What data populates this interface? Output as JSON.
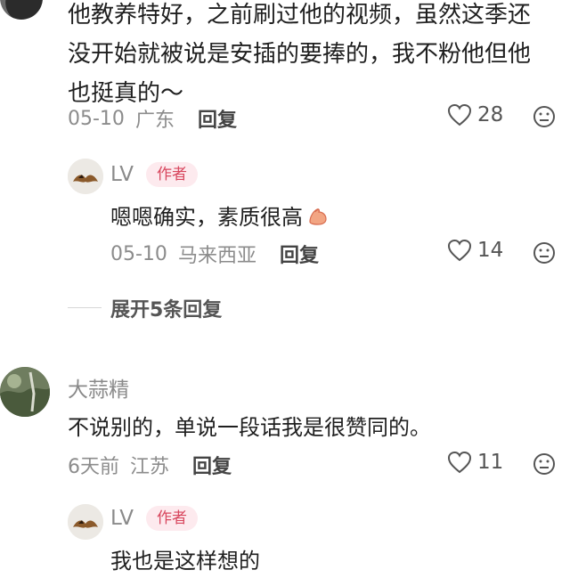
{
  "comments": [
    {
      "text_lines": [
        "他教养特好，之前刷过他的视频，虽然这季还",
        "没开始就被说是安插的要捧的，我不粉他但他",
        "也挺真的～"
      ],
      "date": "05-10",
      "location": "广东",
      "reply_label": "回复",
      "likes": "28",
      "replies": [
        {
          "username": "LV",
          "badge": "作者",
          "text": "嗯嗯确实，素质很高",
          "date": "05-10",
          "location": "马来西亚",
          "reply_label": "回复",
          "likes": "14"
        }
      ],
      "expand_label": "展开5条回复"
    },
    {
      "username": "大蒜精",
      "text": "不说别的，单说一段话我是很赞同的。",
      "date": "6天前",
      "location": "江苏",
      "reply_label": "回复",
      "likes": "11",
      "replies": [
        {
          "username": "LV",
          "badge": "作者",
          "text": "我也是这样想的"
        }
      ]
    }
  ],
  "colors": {
    "badge_text": "#d8475e",
    "badge_bg": "#fdeaee",
    "meta": "#8c8c8c"
  },
  "icons": {
    "like": "heart-outline-icon",
    "dislike": "neutral-face-icon",
    "reply_emoji": "strong-arm-emoji"
  }
}
